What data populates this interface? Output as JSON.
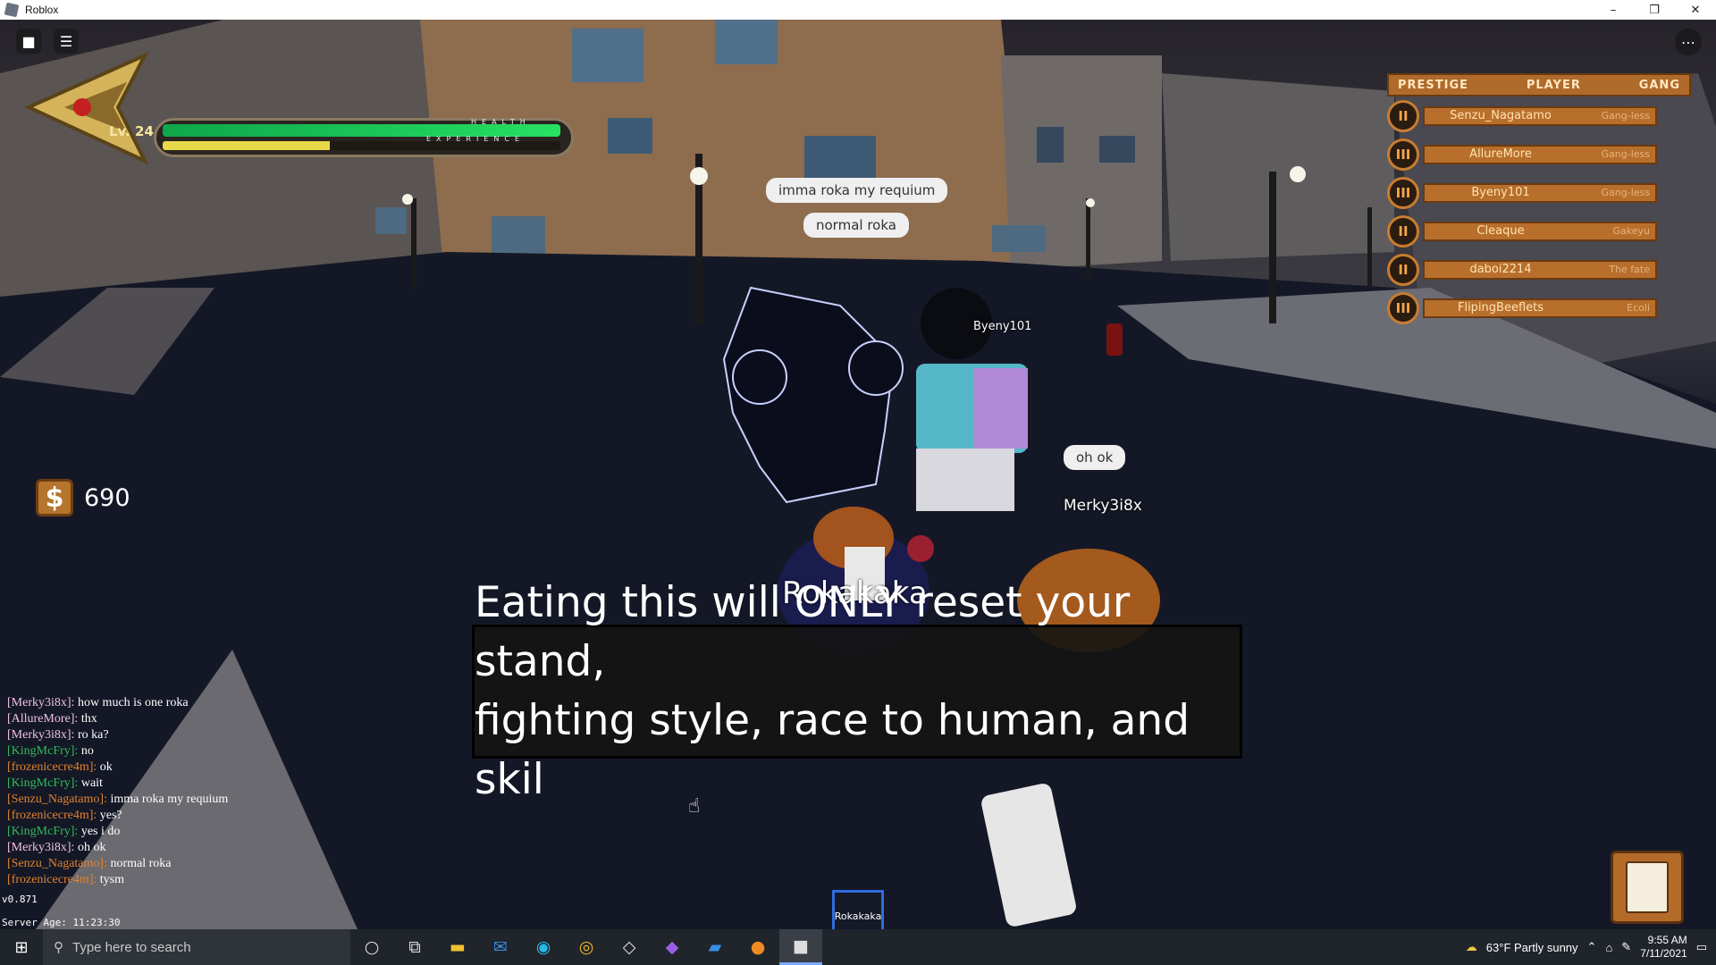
{
  "window": {
    "title": "Roblox",
    "controls": [
      "–",
      "❐",
      "✕"
    ]
  },
  "hud": {
    "level": "Lv. 24",
    "health_label": "HEALTH",
    "experience_label": "EXPERIENCE",
    "health_fraction": 1.0,
    "experience_fraction": 0.42,
    "money_symbol": "$",
    "money": "690"
  },
  "playerlist": {
    "headers": {
      "prestige": "PRESTIGE",
      "player": "PLAYER",
      "gang": "GANG"
    },
    "rows": [
      {
        "prestige": "II",
        "name": "Senzu_Nagatamo",
        "gang": "Gang-less"
      },
      {
        "prestige": "III",
        "name": "AllureMore",
        "gang": "Gang-less"
      },
      {
        "prestige": "III",
        "name": "Byeny101",
        "gang": "Gang-less"
      },
      {
        "prestige": "II",
        "name": "Cleaque",
        "gang": "Gakeyu"
      },
      {
        "prestige": "II",
        "name": "daboi2214",
        "gang": "The fate"
      },
      {
        "prestige": "III",
        "name": "FlipingBeeflets",
        "gang": "Ecoli"
      }
    ]
  },
  "bubbles": {
    "b1": "imma roka my requium",
    "b2": "normal roka",
    "b3": "oh ok"
  },
  "nametags": {
    "byeny": "Byeny101",
    "merky": "Merky3i8x",
    "item": "Rokakaka"
  },
  "subtitle": {
    "line1": "Eating this will ONLY reset your stand,",
    "line2": "fighting style, race to human, and skil"
  },
  "chat": [
    {
      "name": "[Merky3i8x]:",
      "color": "#f0c0e6",
      "msg": "how much is one roka"
    },
    {
      "name": "[AllureMore]:",
      "color": "#f0c0e6",
      "msg": "thx"
    },
    {
      "name": "[Merky3i8x]:",
      "color": "#f0c0e6",
      "msg": "ro ka?"
    },
    {
      "name": "[KingMcFry]:",
      "color": "#2ebc5a",
      "msg": "no"
    },
    {
      "name": "[frozenicecre4m]:",
      "color": "#e0822e",
      "msg": "ok"
    },
    {
      "name": "[KingMcFry]:",
      "color": "#2ebc5a",
      "msg": "wait"
    },
    {
      "name": "[Senzu_Nagatamo]:",
      "color": "#e0822e",
      "msg": "imma roka my requium"
    },
    {
      "name": "[frozenicecre4m]:",
      "color": "#e0822e",
      "msg": "yes?"
    },
    {
      "name": "[KingMcFry]:",
      "color": "#2ebc5a",
      "msg": "yes i do"
    },
    {
      "name": "[Merky3i8x]:",
      "color": "#f0c0e6",
      "msg": "oh ok"
    },
    {
      "name": "[Senzu_Nagatamo]:",
      "color": "#e0822e",
      "msg": "normal roka"
    },
    {
      "name": "[frozenicecre4m]:",
      "color": "#e0822e",
      "msg": "tysm"
    }
  ],
  "version": "v0.871",
  "server_age": "Server Age: 11:23:30",
  "hotbar": {
    "slot1": "Rokakaka"
  },
  "taskbar": {
    "search_placeholder": "Type here to search",
    "weather": "63°F  Partly sunny",
    "time": "9:55 AM",
    "date": "7/11/2021"
  }
}
